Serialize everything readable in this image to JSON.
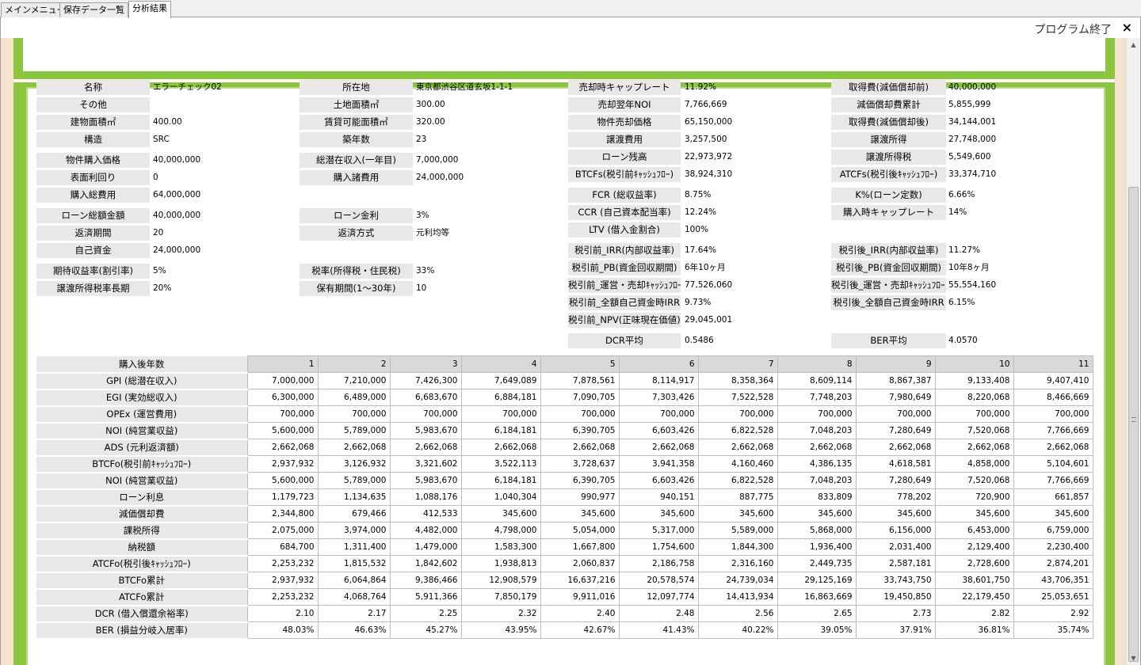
{
  "tabs": [
    "メインメニュー",
    "保存データ一覧",
    "分析結果"
  ],
  "header": {
    "exit_label": "プログラム終了",
    "close_glyph": "×"
  },
  "summary": {
    "col1": [
      {
        "label": "名称",
        "value": "エラーチェック02"
      },
      {
        "label": "その他",
        "value": ""
      },
      {
        "label": "建物面積㎡",
        "value": "400.00"
      },
      {
        "label": "構造",
        "value": "SRC"
      },
      {
        "label": "物件購入価格",
        "value": "40,000,000"
      },
      {
        "label": "表面利回り",
        "value": "0"
      },
      {
        "label": "購入総費用",
        "value": "64,000,000"
      },
      {
        "label": "ローン総額金額",
        "value": "40,000,000"
      },
      {
        "label": "返済期間",
        "value": "20"
      },
      {
        "label": "自己資金",
        "value": "24,000,000"
      },
      {
        "label": "期待収益率(割引率)",
        "value": "5%"
      },
      {
        "label": "譲渡所得税率長期",
        "value": "20%"
      }
    ],
    "col2": [
      {
        "label": "所在地",
        "value": "東京都渋谷区道玄坂1-1-1"
      },
      {
        "label": "土地面積㎡",
        "value": "300.00"
      },
      {
        "label": "賃貸可能面積㎡",
        "value": "320.00"
      },
      {
        "label": "築年数",
        "value": "23"
      },
      {
        "label": "総潜在収入(一年目)",
        "value": "7,000,000"
      },
      {
        "label": "購入諸費用",
        "value": "24,000,000"
      },
      {
        "label": "ローン金利",
        "value": "3%"
      },
      {
        "label": "返済方式",
        "value": "元利均等"
      },
      {
        "label": "税率(所得税・住民税)",
        "value": "33%"
      },
      {
        "label": "保有期間(1〜30年)",
        "value": "10"
      }
    ],
    "col3": [
      {
        "label": "売却時キャップレート",
        "value": "11.92%"
      },
      {
        "label": "売却翌年NOI",
        "value": "7,766,669"
      },
      {
        "label": "物件売却価格",
        "value": "65,150,000"
      },
      {
        "label": "譲渡費用",
        "value": "3,257,500"
      },
      {
        "label": "ローン残高",
        "value": "22,973,972"
      },
      {
        "label": "BTCFs(税引前ｷｬｯｼｭﾌﾛｰ)",
        "value": "38,924,310"
      },
      {
        "label": "FCR (総収益率)",
        "value": "8.75%"
      },
      {
        "label": "CCR (自己資本配当率)",
        "value": "12.24%"
      },
      {
        "label": "LTV (借入金割合)",
        "value": "100%"
      },
      {
        "label": "税引前_IRR(内部収益率)",
        "value": "17.64%"
      },
      {
        "label": "税引前_PB(資金回収期間)",
        "value": "6年10ヶ月"
      },
      {
        "label": "税引前_運営・売却ｷｬｯｼｭﾌﾛｰ累計",
        "value": "77,526,060"
      },
      {
        "label": "税引前_全額自己資金時IRR",
        "value": "9.73%"
      },
      {
        "label": "税引前_NPV(正味現在価値)",
        "value": "29,045,001"
      },
      {
        "label": "DCR平均",
        "value": "0.5486"
      }
    ],
    "col4": [
      {
        "label": "取得費(減価償却前)",
        "value": "40,000,000"
      },
      {
        "label": "減価償却費累計",
        "value": "5,855,999"
      },
      {
        "label": "取得費(減価償却後)",
        "value": "34,144,001"
      },
      {
        "label": "譲渡所得",
        "value": "27,748,000"
      },
      {
        "label": "譲渡所得税",
        "value": "5,549,600"
      },
      {
        "label": "ATCFs(税引後ｷｬｯｼｭﾌﾛｰ)",
        "value": "33,374,710"
      },
      {
        "label": "K%(ローン定数)",
        "value": "6.66%"
      },
      {
        "label": "購入時キャップレート",
        "value": "14%"
      },
      {
        "label": "税引後_IRR(内部収益率)",
        "value": "11.27%"
      },
      {
        "label": "税引後_PB(資金回収期間)",
        "value": "10年8ヶ月"
      },
      {
        "label": "税引後_運営・売却ｷｬｯｼｭﾌﾛｰ累計",
        "value": "55,554,160"
      },
      {
        "label": "税引後_全額自己資金時IRR",
        "value": "6.15%"
      },
      {
        "label": "BER平均",
        "value": "4.0570"
      }
    ]
  },
  "cashflow": {
    "corner_label": "購入後年数",
    "years": [
      "1",
      "2",
      "3",
      "4",
      "5",
      "6",
      "7",
      "8",
      "9",
      "10",
      "11"
    ],
    "rows": [
      {
        "label": "GPI (総潜在収入)",
        "values": [
          "7,000,000",
          "7,210,000",
          "7,426,300",
          "7,649,089",
          "7,878,561",
          "8,114,917",
          "8,358,364",
          "8,609,114",
          "8,867,387",
          "9,133,408",
          "9,407,410"
        ]
      },
      {
        "label": "EGI (実効総収入)",
        "values": [
          "6,300,000",
          "6,489,000",
          "6,683,670",
          "6,884,181",
          "7,090,705",
          "7,303,426",
          "7,522,528",
          "7,748,203",
          "7,980,649",
          "8,220,068",
          "8,466,669"
        ]
      },
      {
        "label": "OPEx (運営費用)",
        "values": [
          "700,000",
          "700,000",
          "700,000",
          "700,000",
          "700,000",
          "700,000",
          "700,000",
          "700,000",
          "700,000",
          "700,000",
          "700,000"
        ]
      },
      {
        "label": "NOI (純営業収益)",
        "values": [
          "5,600,000",
          "5,789,000",
          "5,983,670",
          "6,184,181",
          "6,390,705",
          "6,603,426",
          "6,822,528",
          "7,048,203",
          "7,280,649",
          "7,520,068",
          "7,766,669"
        ]
      },
      {
        "label": "ADS (元利返済額)",
        "values": [
          "2,662,068",
          "2,662,068",
          "2,662,068",
          "2,662,068",
          "2,662,068",
          "2,662,068",
          "2,662,068",
          "2,662,068",
          "2,662,068",
          "2,662,068",
          "2,662,068"
        ]
      },
      {
        "label": "BTCFo(税引前ｷｬｯｼｭﾌﾛｰ)",
        "values": [
          "2,937,932",
          "3,126,932",
          "3,321,602",
          "3,522,113",
          "3,728,637",
          "3,941,358",
          "4,160,460",
          "4,386,135",
          "4,618,581",
          "4,858,000",
          "5,104,601"
        ]
      },
      {
        "label": "NOI (純営業収益)",
        "values": [
          "5,600,000",
          "5,789,000",
          "5,983,670",
          "6,184,181",
          "6,390,705",
          "6,603,426",
          "6,822,528",
          "7,048,203",
          "7,280,649",
          "7,520,068",
          "7,766,669"
        ]
      },
      {
        "label": "ローン利息",
        "values": [
          "1,179,723",
          "1,134,635",
          "1,088,176",
          "1,040,304",
          "990,977",
          "940,151",
          "887,775",
          "833,809",
          "778,202",
          "720,900",
          "661,857"
        ]
      },
      {
        "label": "減価償却費",
        "values": [
          "2,344,800",
          "679,466",
          "412,533",
          "345,600",
          "345,600",
          "345,600",
          "345,600",
          "345,600",
          "345,600",
          "345,600",
          "345,600"
        ]
      },
      {
        "label": "課税所得",
        "values": [
          "2,075,000",
          "3,974,000",
          "4,482,000",
          "4,798,000",
          "5,054,000",
          "5,317,000",
          "5,589,000",
          "5,868,000",
          "6,156,000",
          "6,453,000",
          "6,759,000"
        ]
      },
      {
        "label": "納税額",
        "values": [
          "684,700",
          "1,311,400",
          "1,479,000",
          "1,583,300",
          "1,667,800",
          "1,754,600",
          "1,844,300",
          "1,936,400",
          "2,031,400",
          "2,129,400",
          "2,230,400"
        ]
      },
      {
        "label": "ATCFo(税引後ｷｬｯｼｭﾌﾛｰ)",
        "values": [
          "2,253,232",
          "1,815,532",
          "1,842,602",
          "1,938,813",
          "2,060,837",
          "2,186,758",
          "2,316,160",
          "2,449,735",
          "2,587,181",
          "2,728,600",
          "2,874,201"
        ]
      },
      {
        "label": "BTCFo累計",
        "values": [
          "2,937,932",
          "6,064,864",
          "9,386,466",
          "12,908,579",
          "16,637,216",
          "20,578,574",
          "24,739,034",
          "29,125,169",
          "33,743,750",
          "38,601,750",
          "43,706,351"
        ]
      },
      {
        "label": "ATCFo累計",
        "values": [
          "2,253,232",
          "4,068,764",
          "5,911,366",
          "7,850,179",
          "9,911,016",
          "12,097,774",
          "14,413,934",
          "16,863,669",
          "19,450,850",
          "22,179,450",
          "25,053,651"
        ]
      },
      {
        "label": "DCR (借入償還余裕率)",
        "values": [
          "2.10",
          "2.17",
          "2.25",
          "2.32",
          "2.40",
          "2.48",
          "2.56",
          "2.65",
          "2.73",
          "2.82",
          "2.92"
        ]
      },
      {
        "label": "BER (損益分岐入居率)",
        "values": [
          "48.03%",
          "46.63%",
          "45.27%",
          "43.95%",
          "42.67%",
          "41.43%",
          "40.22%",
          "39.05%",
          "37.91%",
          "36.81%",
          "35.74%"
        ]
      }
    ]
  },
  "scrollbar": {
    "up_glyph": "▲",
    "down_glyph": "▼"
  },
  "colors": {
    "accent_green": "#8cc63f",
    "sidebar": "#f3e3cf",
    "label_bg": "#e8e8e8"
  }
}
